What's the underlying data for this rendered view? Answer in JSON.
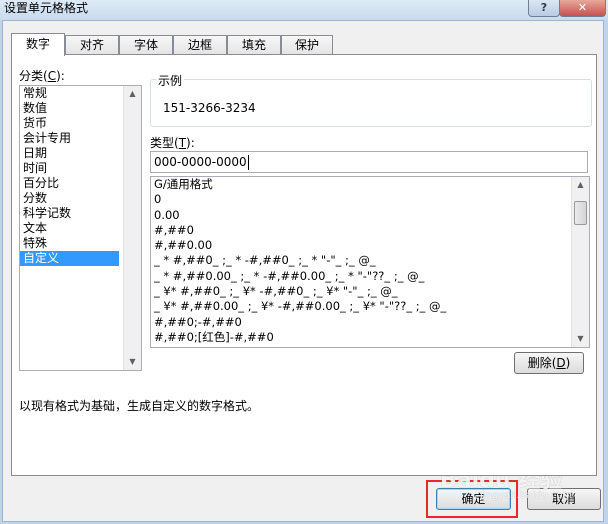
{
  "window": {
    "title": "设置单元格格式",
    "help_label": "?",
    "close_label": "✕"
  },
  "tabs": [
    {
      "label": "数字"
    },
    {
      "label": "对齐"
    },
    {
      "label": "字体"
    },
    {
      "label": "边框"
    },
    {
      "label": "填充"
    },
    {
      "label": "保护"
    }
  ],
  "category": {
    "label_prefix": "分类(",
    "label_key": "C",
    "label_suffix": "):",
    "items": [
      "常规",
      "数值",
      "货币",
      "会计专用",
      "日期",
      "时间",
      "百分比",
      "分数",
      "科学记数",
      "文本",
      "特殊",
      "自定义"
    ],
    "selected": "自定义"
  },
  "sample": {
    "legend": "示例",
    "value": "151-3266-3234"
  },
  "type": {
    "label_prefix": "类型(",
    "label_key": "T",
    "label_suffix": "):",
    "value": "000-0000-0000"
  },
  "formats": [
    "G/通用格式",
    "0",
    "0.00",
    "#,##0",
    "#,##0.00",
    "_ * #,##0_ ;_ * -#,##0_ ;_ * \"-\"_ ;_ @_",
    "_ * #,##0.00_ ;_ * -#,##0.00_ ;_ * \"-\"??_ ;_ @_",
    "_ ¥* #,##0_ ;_ ¥* -#,##0_ ;_ ¥* \"-\"_ ;_ @_",
    "_ ¥* #,##0.00_ ;_ ¥* -#,##0.00_ ;_ ¥* \"-\"??_ ;_ @_",
    "#,##0;-#,##0",
    "#,##0;[红色]-#,##0"
  ],
  "buttons": {
    "delete_prefix": "删除(",
    "delete_key": "D",
    "delete_suffix": ")",
    "ok": "确定",
    "cancel": "取消"
  },
  "description": "以现有格式为基础，生成自定义的数字格式。",
  "watermark": {
    "text": "Baidu 经验",
    "sub": "jingyan.baidu.com"
  },
  "colors": {
    "highlight": "#e8282b",
    "selection": "#3399ff"
  }
}
